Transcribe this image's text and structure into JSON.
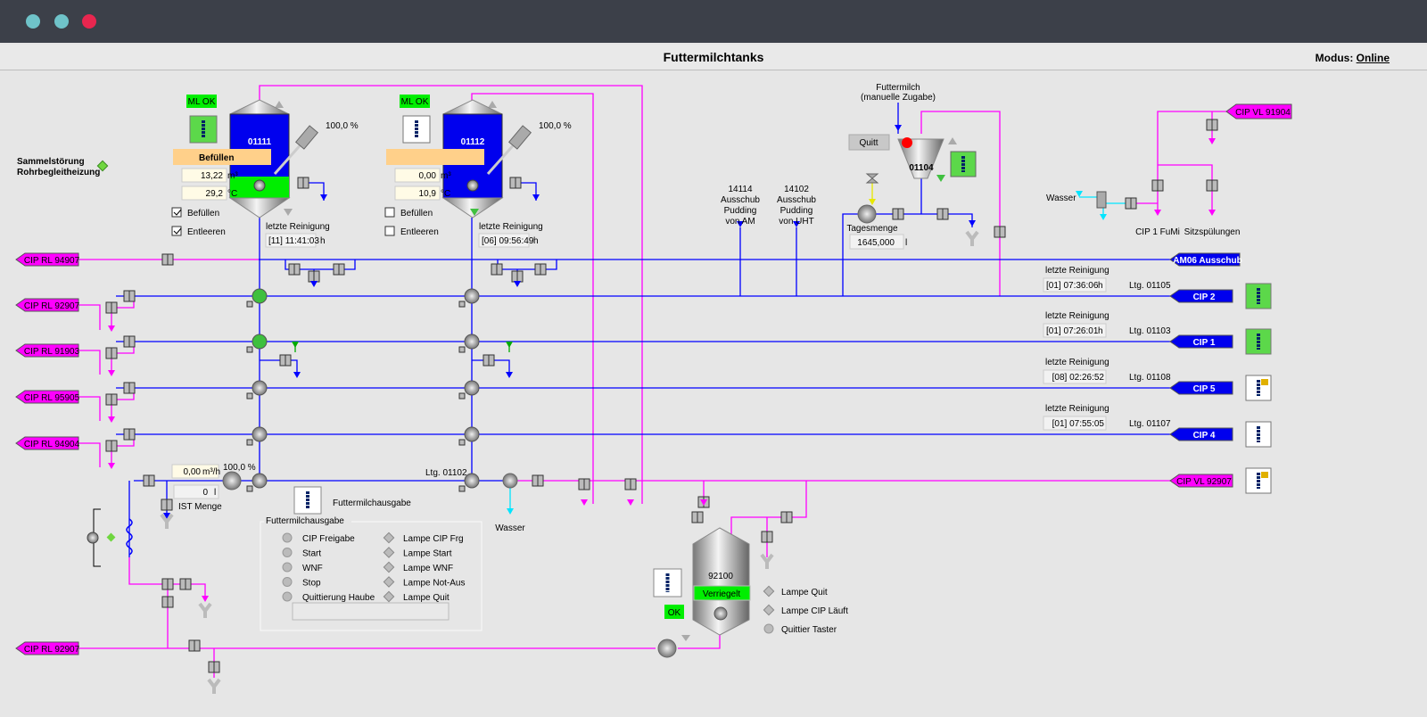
{
  "header": {
    "title": "Futtermilchtanks",
    "mode_label": "Modus:",
    "mode_value": "Online"
  },
  "colors": {
    "product_line": "#0000ff",
    "cip_line": "#ff00ff",
    "water_line": "#00e5ff",
    "ok_green": "#00ee00",
    "state_orange": "#ffd08a",
    "tank_blue": "#0000ee"
  },
  "alarm": {
    "line1": "Sammelstörung",
    "line2": "Rohrbegleitheizung"
  },
  "tanks": [
    {
      "id": "01111",
      "badge": "ML OK",
      "state": "Befüllen",
      "volume": "13,22",
      "volume_unit": "m³",
      "temp": "29,2",
      "temp_unit": "°C",
      "agitator": "100,0  %",
      "fill_label": "Befüllen",
      "fill_checked": true,
      "empty_label": "Entleeren",
      "empty_checked": true,
      "clean_label": "letzte Reinigung",
      "clean_value": "[11] 11:41:03",
      "clean_unit": "h",
      "level_percent": 25
    },
    {
      "id": "01112",
      "badge": "ML OK",
      "state": "",
      "volume": "0,00",
      "volume_unit": "m³",
      "temp": "10,9",
      "temp_unit": "°C",
      "agitator": "100,0  %",
      "fill_label": "Befüllen",
      "fill_checked": false,
      "empty_label": "Entleeren",
      "empty_checked": false,
      "clean_label": "letzte Reinigung",
      "clean_value": "[06] 09:56:49",
      "clean_unit": "h",
      "level_percent": 0
    }
  ],
  "left_returns": [
    "CIP RL 94907",
    "CIP RL 92907",
    "CIP RL 91903",
    "CIP RL 95905",
    "CIP RL 94904",
    "CIP RL 92907"
  ],
  "right_lines": {
    "am06": "AM06 Ausschub",
    "cip": [
      {
        "label": "CIP 2",
        "ltg": "Ltg. 01105",
        "clean_label": "letzte Reinigung",
        "clean_value": "[01] 07:36:06",
        "unit": "h",
        "status": "active"
      },
      {
        "label": "CIP 1",
        "ltg": "Ltg. 01103",
        "clean_label": "letzte Reinigung",
        "clean_value": "[01] 07:26:01",
        "unit": "h",
        "status": "active"
      },
      {
        "label": "CIP 5",
        "ltg": "Ltg. 01108",
        "clean_label": "letzte Reinigung",
        "clean_value": "[08] 02:26:52",
        "unit": "",
        "status": "locked"
      },
      {
        "label": "CIP 4",
        "ltg": "Ltg. 01107",
        "clean_label": "letzte Reinigung",
        "clean_value": "[01] 07:55:05",
        "unit": "",
        "status": "idle"
      }
    ],
    "cip_vl": "CIP VL 92907"
  },
  "sources": [
    {
      "l1": "14114",
      "l2": "Ausschub",
      "l3": "Pudding",
      "l4": "von AM"
    },
    {
      "l1": "14102",
      "l2": "Ausschub",
      "l3": "Pudding",
      "l4": "von UHT"
    }
  ],
  "hopper": {
    "label1": "Futtermilch",
    "label2": "(manuelle Zugabe)",
    "quitt": "Quitt",
    "id": "01104",
    "daily_label": "Tagesmenge",
    "daily_value": "1645,000",
    "daily_unit": "l"
  },
  "top_right": {
    "cip_vl": "CIP VL 91904",
    "water": "Wasser",
    "cip_fumi": "CIP 1 FuMi",
    "seat": "Sitzspülungen"
  },
  "outlet": {
    "flow": "0,00",
    "flow_unit": "m³/h",
    "pump": "100,0  %",
    "ist_value": "0",
    "ist_unit": "l",
    "ist_label": "IST Menge",
    "ltg": "Ltg. 01102",
    "water": "Wasser",
    "icon_label": "Futtermilchausgabe"
  },
  "panel": {
    "title": "Futtermilchausgabe",
    "inputs": [
      "CIP Freigabe",
      "Start",
      "WNF",
      "Stop",
      "Quittierung Haube"
    ],
    "lamps": [
      "Lampe CIP Frg",
      "Lampe Start",
      "Lampe WNF",
      "Lampe Not-Aus",
      "Lampe Quit"
    ]
  },
  "tank92100": {
    "id": "92100",
    "state": "Verriegelt",
    "ok": "OK",
    "lamps": [
      "Lampe Quit",
      "Lampe CIP Läuft"
    ],
    "taster": "Quittier Taster"
  }
}
